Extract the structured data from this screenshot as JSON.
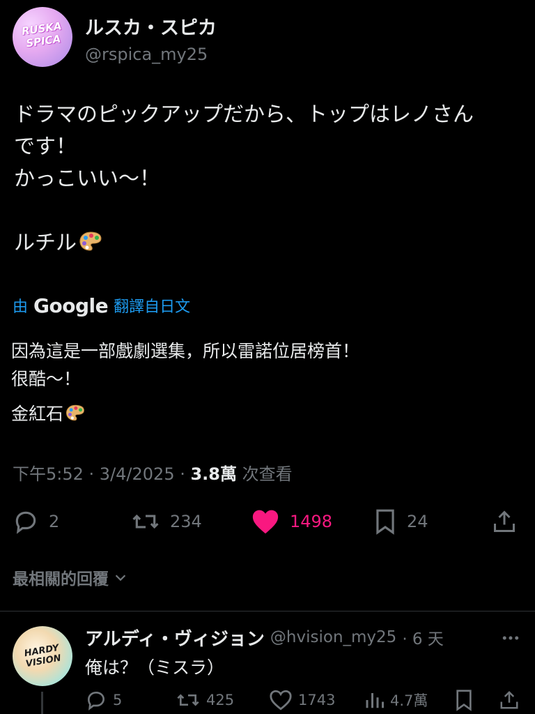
{
  "tweet": {
    "author": {
      "display_name": "ルスカ・スピカ",
      "handle": "@rspica_my25",
      "avatar_text": "RUSKA SPICA"
    },
    "text": "ドラマのピックアップだから、トップはレノさん\nです！\nかっこいい〜！\n\nルチル",
    "text_emoji": "artist-palette-emoji",
    "translation": {
      "prefix": "由",
      "provider": "Google",
      "suffix": "翻譯自日文",
      "lines": [
        "因為這是一部戲劇選集，所以雷諾位居榜首！",
        "很酷～！",
        "金紅石"
      ],
      "emoji": "artist-palette-emoji"
    },
    "meta": {
      "time": "下午5:52",
      "sep1": " · ",
      "date": "3/4/2025",
      "sep2": " · ",
      "views": "3.8萬",
      "views_label": " 次查看"
    },
    "actions": {
      "replies": "2",
      "retweets": "234",
      "likes": "1498",
      "bookmarks": "24"
    },
    "colors": {
      "like": "#f91880",
      "link": "#1d9bf0",
      "muted": "#71767b",
      "text": "#e7e9ea",
      "background": "#000000"
    }
  },
  "replies_sort": {
    "label": "最相關的回覆",
    "icon": "chevron-down-icon"
  },
  "reply": {
    "display_name": "アルディ・ヴィジョン",
    "handle": "@hvision_my25",
    "age": "· 6 天",
    "avatar_text": "HARDY VISION",
    "text": "俺は？（ミスラ）",
    "actions": {
      "replies": "5",
      "retweets": "425",
      "likes": "1743",
      "views": "4.7萬"
    }
  }
}
